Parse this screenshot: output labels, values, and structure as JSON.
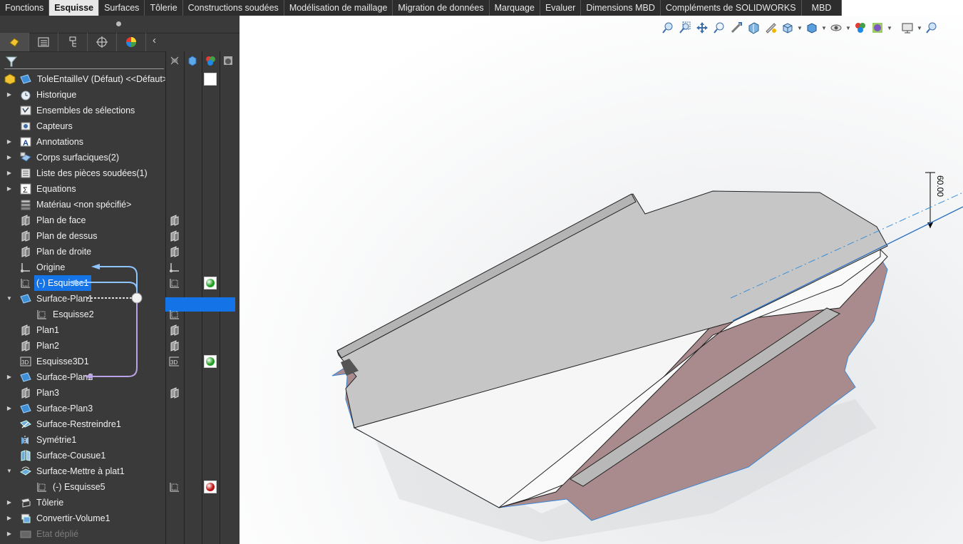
{
  "command_tabs": [
    "Fonctions",
    "Esquisse",
    "Surfaces",
    "Tôlerie",
    "Constructions soudées",
    "Modélisation de maillage",
    "Migration de données",
    "Marquage",
    "Evaluer",
    "Dimensions MBD",
    "Compléments de SOLIDWORKS",
    "MBD"
  ],
  "active_tab": "Esquisse",
  "tree": {
    "root": "ToleEntailleV (Défaut) <<Défaut>_",
    "items": [
      {
        "label": "Historique",
        "icon": "history-icon",
        "expandable": true,
        "indent": 0
      },
      {
        "label": "Ensembles de sélections",
        "icon": "selection-sets-icon",
        "expandable": false,
        "indent": 0
      },
      {
        "label": "Capteurs",
        "icon": "sensor-icon",
        "expandable": false,
        "indent": 0
      },
      {
        "label": "Annotations",
        "icon": "annotation-icon",
        "expandable": true,
        "indent": 0
      },
      {
        "label": "Corps surfaciques(2)",
        "icon": "surface-bodies-icon",
        "expandable": true,
        "indent": 0
      },
      {
        "label": "Liste des pièces soudées(1)",
        "icon": "cut-list-icon",
        "expandable": true,
        "indent": 0
      },
      {
        "label": "Equations",
        "icon": "equations-icon",
        "expandable": true,
        "indent": 0
      },
      {
        "label": "Matériau <non spécifié>",
        "icon": "material-icon",
        "expandable": false,
        "indent": 0
      },
      {
        "label": "Plan de face",
        "icon": "plane-icon",
        "expandable": false,
        "indent": 0
      },
      {
        "label": "Plan de dessus",
        "icon": "plane-icon",
        "expandable": false,
        "indent": 0
      },
      {
        "label": "Plan de droite",
        "icon": "plane-icon",
        "expandable": false,
        "indent": 0
      },
      {
        "label": "Origine",
        "icon": "origin-icon",
        "expandable": false,
        "indent": 0
      },
      {
        "label": "(-) Esquisse1",
        "icon": "sketch-icon",
        "expandable": false,
        "indent": 0,
        "selected": true
      },
      {
        "label": "Surface-Plan1",
        "icon": "planar-surface-icon",
        "expandable": true,
        "expanded": true,
        "indent": 0
      },
      {
        "label": "Esquisse2",
        "icon": "sketch-icon",
        "expandable": false,
        "indent": 1
      },
      {
        "label": "Plan1",
        "icon": "plane-icon",
        "expandable": false,
        "indent": 0
      },
      {
        "label": "Plan2",
        "icon": "plane-icon",
        "expandable": false,
        "indent": 0
      },
      {
        "label": "Esquisse3D1",
        "icon": "3d-sketch-icon",
        "expandable": false,
        "indent": 0
      },
      {
        "label": "Surface-Plan2",
        "icon": "planar-surface-icon",
        "expandable": true,
        "indent": 0
      },
      {
        "label": "Plan3",
        "icon": "plane-icon",
        "expandable": false,
        "indent": 0
      },
      {
        "label": "Surface-Plan3",
        "icon": "planar-surface-icon",
        "expandable": true,
        "indent": 0
      },
      {
        "label": "Surface-Restreindre1",
        "icon": "trim-surface-icon",
        "expandable": false,
        "indent": 0
      },
      {
        "label": "Symétrie1",
        "icon": "mirror-icon",
        "expandable": false,
        "indent": 0
      },
      {
        "label": "Surface-Cousue1",
        "icon": "knit-surface-icon",
        "expandable": false,
        "indent": 0
      },
      {
        "label": "Surface-Mettre à plat1",
        "icon": "flatten-surface-icon",
        "expandable": true,
        "expanded": true,
        "indent": 0
      },
      {
        "label": "(-) Esquisse5",
        "icon": "sketch-icon",
        "expandable": false,
        "indent": 1
      },
      {
        "label": "Tôlerie",
        "icon": "sheet-metal-icon",
        "expandable": true,
        "indent": 0
      },
      {
        "label": "Convertir-Volume1",
        "icon": "convert-solid-icon",
        "expandable": true,
        "indent": 0
      },
      {
        "label": "Etat déplié",
        "icon": "flat-pattern-icon",
        "expandable": true,
        "indent": 0,
        "disabled": true
      }
    ]
  },
  "columns": [
    {
      "row": 8,
      "icon": "plane-icon"
    },
    {
      "row": 9,
      "icon": "plane-icon"
    },
    {
      "row": 10,
      "icon": "plane-icon"
    },
    {
      "row": 11,
      "icon": "origin-icon"
    },
    {
      "row": 12,
      "icon": "sketch-icon",
      "state": "green"
    },
    {
      "row": 14,
      "icon": "sketch-icon"
    },
    {
      "row": 15,
      "icon": "plane-icon"
    },
    {
      "row": 16,
      "icon": "plane-icon"
    },
    {
      "row": 17,
      "icon": "3d-sketch-icon",
      "state": "green"
    },
    {
      "row": 19,
      "icon": "plane-icon"
    },
    {
      "row": 25,
      "icon": "sketch-icon",
      "state": "red"
    }
  ],
  "root_state": "white",
  "dimension_label": "60.00",
  "colors": {
    "accent": "#1473e6",
    "panel": "#3a3a3a",
    "green": "#1e9e1e",
    "red": "#c01010",
    "surface_gray": "#c4c4c4",
    "surface_pink": "#a88a8c",
    "surface_white": "#fafafa"
  }
}
